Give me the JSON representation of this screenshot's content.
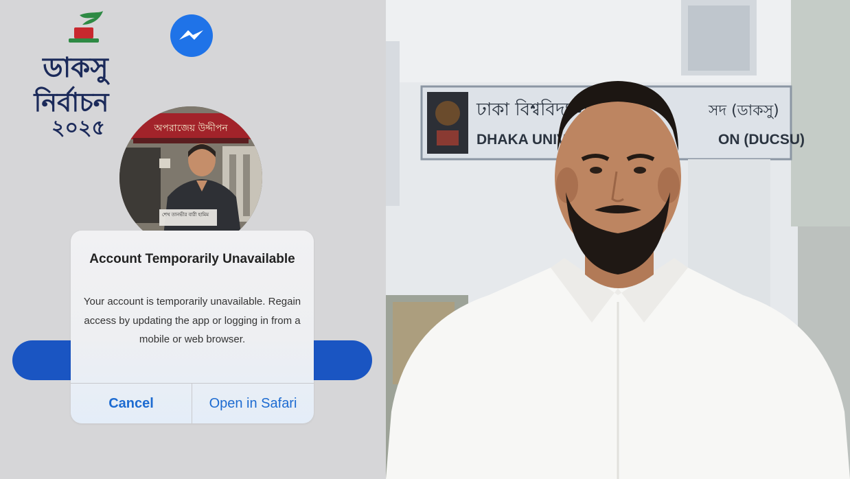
{
  "logo": {
    "line1": "ডাকসু",
    "line2": "নির্বাচন",
    "line3": "২০২৫"
  },
  "icons": {
    "messenger": "messenger-icon"
  },
  "avatar_banner": {
    "top_sign": "অপরাজেয় উদ্দীপন",
    "caption": "শেখ তানভীর বারী হামিম"
  },
  "alert": {
    "title": "Account Temporarily Unavailable",
    "message": "Your account is temporarily unavailable. Regain access by updating the app or logging in from a mobile or web browser.",
    "cancel_label": "Cancel",
    "open_label": "Open in Safari"
  },
  "sign": {
    "bn_left": "ঢাকা বিশ্ববিদ্যাল",
    "bn_right": "সদ (ডাকসু)",
    "en_left": "DHAKA UNIVERSIT",
    "en_right": "ON (DUCSU)"
  },
  "colors": {
    "background": "#d6d6d8",
    "pill": "#1a55c2",
    "alert_button": "#1d6bd1",
    "messenger_blue": "#1f73e8",
    "logo_navy": "#1b2a5a",
    "logo_red": "#c8282e",
    "logo_green": "#2e8a44"
  }
}
